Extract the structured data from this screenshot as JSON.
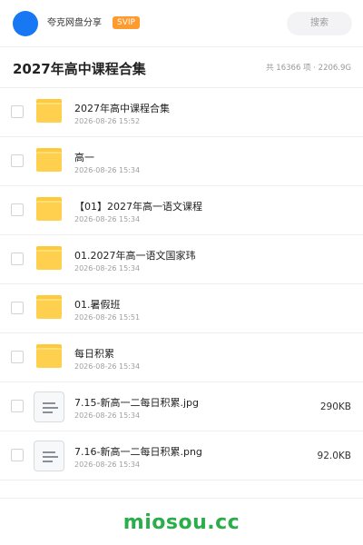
{
  "header": {
    "brand_name": "夸克网盘分享",
    "badge": "SVIP",
    "search_label": "搜索"
  },
  "titlebar": {
    "title": "2027年高中课程合集",
    "meta": "共 16366 项 · 2206.9G"
  },
  "items": [
    {
      "type": "folder",
      "icon": "folder-icon",
      "name": "2027年高中课程合集",
      "date": "2026-08-26 15:52",
      "size": ""
    },
    {
      "type": "folder",
      "icon": "folder-icon",
      "name": "高一",
      "date": "2026-08-26 15:34",
      "size": ""
    },
    {
      "type": "folder",
      "icon": "folder-icon",
      "name": "【01】2027年高一语文课程",
      "date": "2026-08-26 15:34",
      "size": ""
    },
    {
      "type": "folder",
      "icon": "folder-icon",
      "name": "01.2027年高一语文国家玮",
      "date": "2026-08-26 15:34",
      "size": ""
    },
    {
      "type": "folder",
      "icon": "folder-icon",
      "name": "01.暑假班",
      "date": "2026-08-26 15:51",
      "size": ""
    },
    {
      "type": "folder",
      "icon": "folder-icon",
      "name": "每日积累",
      "date": "2026-08-26 15:34",
      "size": ""
    },
    {
      "type": "file",
      "icon": "document-icon",
      "name": "7.15-新高一二每日积累.jpg",
      "date": "2026-08-26 15:34",
      "size": "290KB"
    },
    {
      "type": "file",
      "icon": "document-icon",
      "name": "7.16-新高一二每日积累.png",
      "date": "2026-08-26 15:34",
      "size": "92.0KB"
    }
  ],
  "watermark": "miosou.cc",
  "colors": {
    "accent": "#1877f2",
    "badge": "#ff9a2e",
    "folder": "#ffd04d",
    "watermark": "#2aad4a"
  }
}
